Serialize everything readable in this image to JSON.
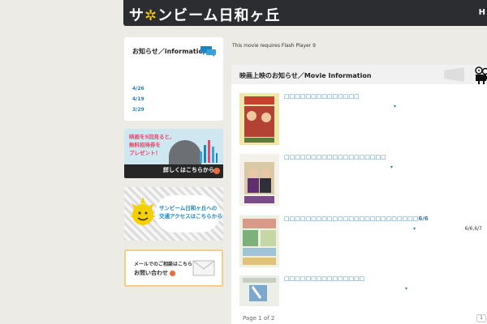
{
  "header": {
    "logo_text_a": "サ",
    "logo_text_b": "ンビ",
    "logo_text_c": "ーム日和ヶ丘",
    "nav_label": "H"
  },
  "sidebar": {
    "info_title": "お知らせ／information",
    "dates": [
      "4/26",
      "4/19",
      "3/29"
    ]
  },
  "banners": {
    "ticket_text_1": "映画を5回見ると、",
    "ticket_text_2": "無料招待券を",
    "ticket_text_3": "プレゼント！",
    "ticket_link": "詳しくはこちらから",
    "access_text_1": "サンビーム日和ヶ丘への",
    "access_text_2": "交通アクセスは",
    "access_link": "こちらから",
    "contact_text_1": "メールでのご相談はこちら",
    "contact_link": "お問い合わせ"
  },
  "main": {
    "flash_note": "This movie requires Flash Player 9",
    "title": "映画上映のお知らせ／Movie Information",
    "items": [
      {
        "title": "□□□□□□□□□□□□□□",
        "mark": "▾",
        "right": ""
      },
      {
        "title": "□□□□□□□□□□□□□□□□□□□",
        "mark": "▾",
        "right": ""
      },
      {
        "title": "□□□□□□□□□□□□□□□□□□□□□□□□□6/6",
        "mark": "▾",
        "right": "6/6,6/7"
      },
      {
        "title": "□□□□□□□□□□□□□□□",
        "mark": "▾",
        "right": ""
      }
    ],
    "page_label": "Page 1 of 2",
    "page_button": "1"
  },
  "colors": {
    "header_bg": "#2b2d31",
    "link_blue": "#2a7fb5",
    "logo_yellow": "#f4d000",
    "accent_orange": "#ef6c3a"
  }
}
